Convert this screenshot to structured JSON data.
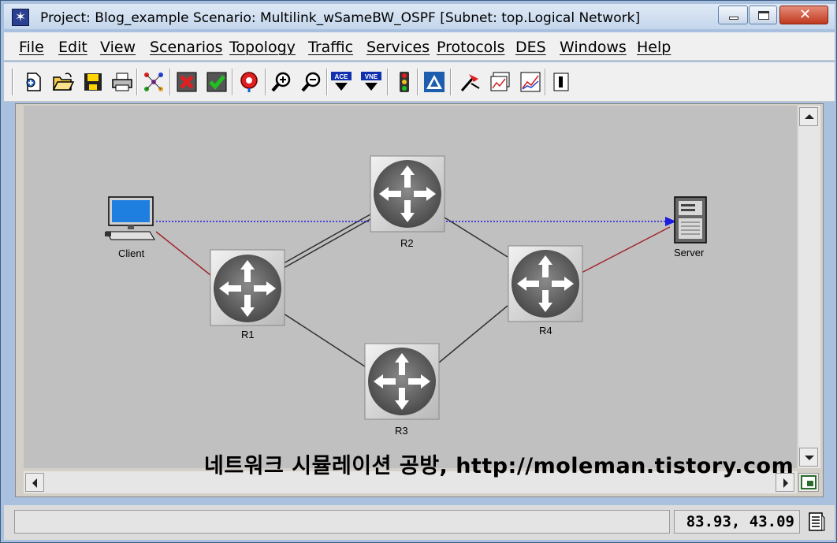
{
  "window": {
    "title": "Project: Blog_example Scenario: Multilink_wSameBW_OSPF  [Subnet: top.Logical Network]"
  },
  "menu": [
    {
      "label": "File"
    },
    {
      "label": "Edit"
    },
    {
      "label": "View"
    },
    {
      "label": "Scenarios"
    },
    {
      "label": "Topology"
    },
    {
      "label": "Traffic"
    },
    {
      "label": "Services"
    },
    {
      "label": "Protocols"
    },
    {
      "label": "DES"
    },
    {
      "label": "Windows"
    },
    {
      "label": "Help"
    }
  ],
  "toolbar": {
    "icons": [
      "new-file-icon",
      "open-folder-icon",
      "save-icon",
      "print-icon",
      "rapid-configuration-icon",
      "fail-link-icon",
      "recover-link-icon",
      "find-node-icon",
      "zoom-in-icon",
      "zoom-out-icon",
      "ace-icon",
      "vne-icon",
      "traffic-light-icon",
      "configure-discrete-event-icon",
      "run-simulation-icon",
      "view-results-icon",
      "view-statistics-icon",
      "hide-graphs-icon"
    ],
    "ace_text": "ACE",
    "vne_text": "VNE"
  },
  "network": {
    "nodes": [
      {
        "id": "client",
        "label": "Client",
        "kind": "workstation"
      },
      {
        "id": "r1",
        "label": "R1",
        "kind": "router"
      },
      {
        "id": "r2",
        "label": "R2",
        "kind": "router"
      },
      {
        "id": "r3",
        "label": "R3",
        "kind": "router"
      },
      {
        "id": "r4",
        "label": "R4",
        "kind": "router"
      },
      {
        "id": "server",
        "label": "Server",
        "kind": "server"
      }
    ],
    "links": [
      {
        "from": "client",
        "to": "r1",
        "color": "#a0252a"
      },
      {
        "from": "r1",
        "to": "r2",
        "color": "#303030",
        "count": 2
      },
      {
        "from": "r1",
        "to": "r3",
        "color": "#303030"
      },
      {
        "from": "r2",
        "to": "r4",
        "color": "#303030"
      },
      {
        "from": "r3",
        "to": "r4",
        "color": "#303030"
      },
      {
        "from": "r4",
        "to": "server",
        "color": "#a0252a"
      },
      {
        "from": "client",
        "to": "server",
        "color": "#1a1ae0",
        "style": "dotted-flow"
      }
    ]
  },
  "watermark": "네트워크 시뮬레이션 공방, http://moleman.tistory.com",
  "status": {
    "message": "",
    "coordinates": "83.93, 43.09"
  }
}
